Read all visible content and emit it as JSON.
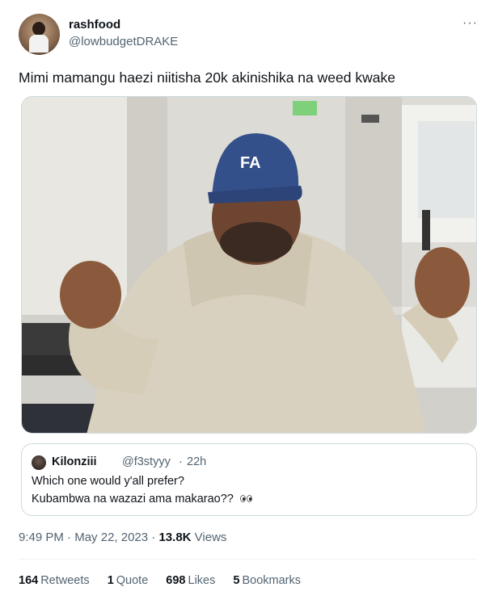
{
  "author": {
    "name": "rashfood",
    "handle": "@lowbudgetDRAKE"
  },
  "more_label": "···",
  "tweet_text": "Mimi mamangu haezi niitisha 20k akinishika na weed kwake",
  "media": {
    "cap_text": "FA"
  },
  "quote": {
    "name": "Kilonziii",
    "handle": "@f3styyy",
    "dot": "·",
    "time": "22h",
    "line1": "Which one would y'all prefer?",
    "line2": "Kubambwa na wazazi ama makarao??",
    "emoji": "eyes-emoji"
  },
  "meta": {
    "time": "9:49 PM",
    "sep": "·",
    "date": "May 22, 2023",
    "views_count": "13.8K",
    "views_label": "Views"
  },
  "stats": [
    {
      "count": "164",
      "label": "Retweets"
    },
    {
      "count": "1",
      "label": "Quote"
    },
    {
      "count": "698",
      "label": "Likes"
    },
    {
      "count": "5",
      "label": "Bookmarks"
    }
  ]
}
